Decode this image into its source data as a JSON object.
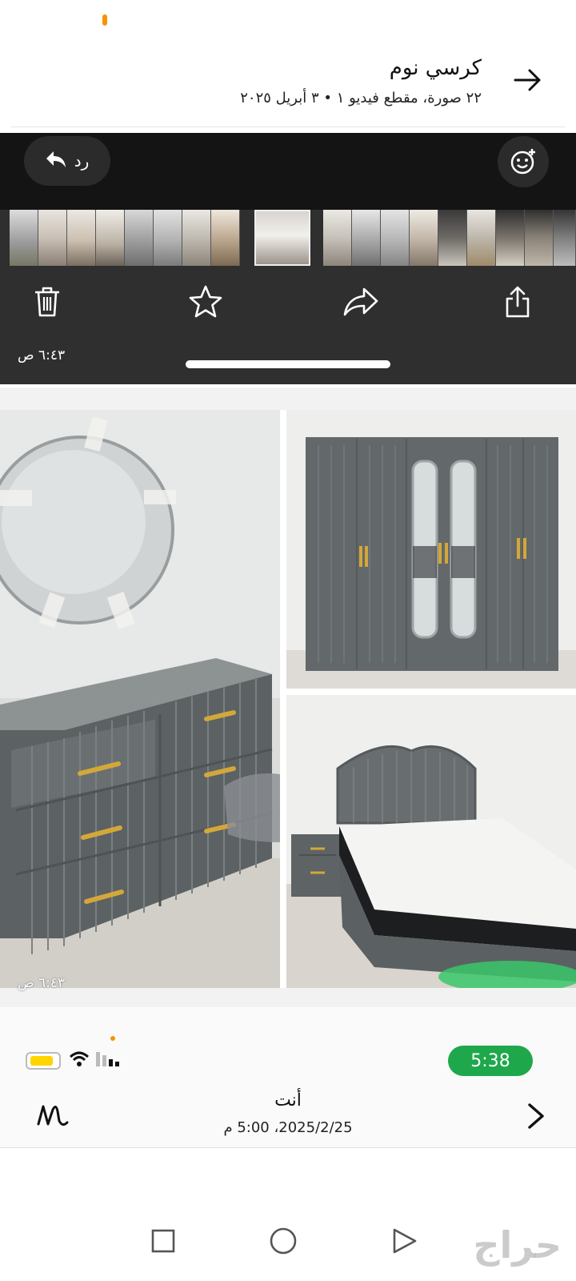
{
  "header": {
    "title": "كرسي نوم",
    "subtitle": "٢٢ صورة، مقطع فيديو ١ • ٣ أبريل ٢٠٢٥",
    "forward_icon": "arrow-right-icon"
  },
  "viewer": {
    "reply_label": "رد",
    "reply_icon": "reply-arrow-icon",
    "emoji_icon": "add-reaction-icon",
    "actions": [
      "trash-icon",
      "star-icon",
      "forward-icon",
      "share-icon"
    ],
    "timestamp": "٦:٤٣ ص",
    "thumbnail_count": 19
  },
  "collage": {
    "timestamp": "٦:٤٣ ص",
    "photos": [
      "mirror-dresser",
      "wardrobe",
      "bed"
    ]
  },
  "status_bar": {
    "time": "5:38",
    "clock_color": "#1ea84b",
    "battery_color": "#ffd400"
  },
  "sender": {
    "name": "أنت",
    "date": "2025/2/25، 5:00 م"
  },
  "navbar": {
    "buttons": [
      "recents-square-icon",
      "home-circle-icon",
      "back-triangle-icon"
    ]
  },
  "watermark": "حراج"
}
